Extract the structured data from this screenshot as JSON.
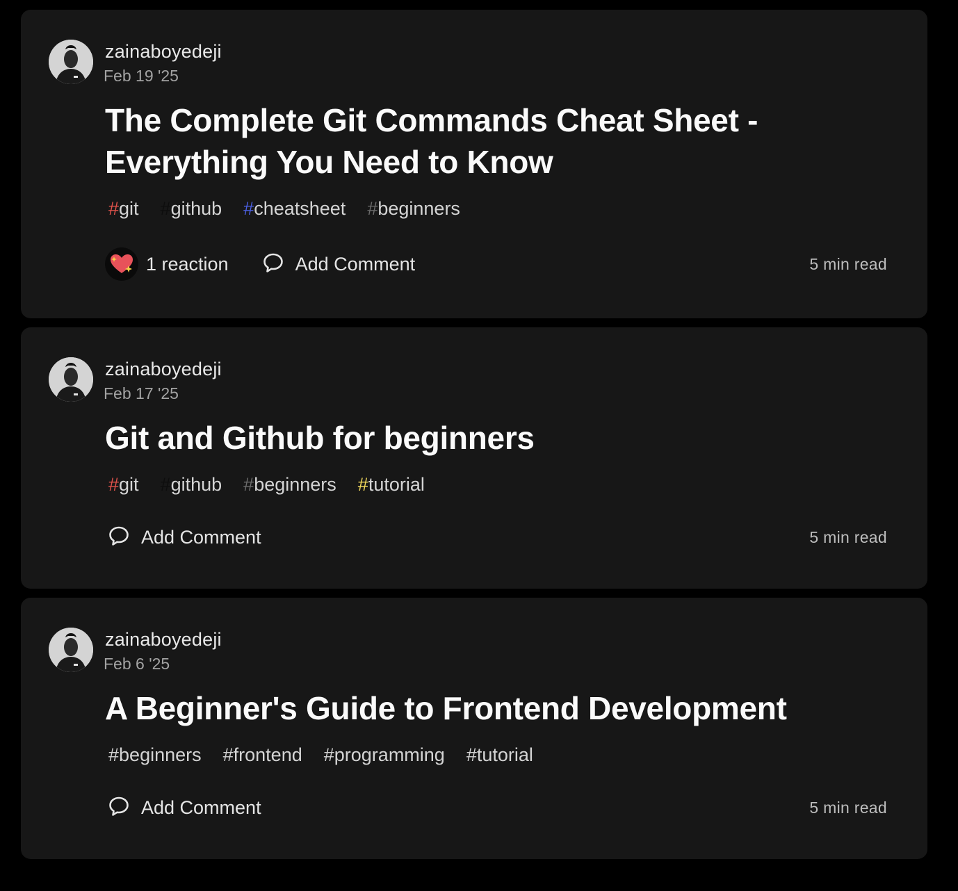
{
  "posts": [
    {
      "author": "zainaboyedeji",
      "date": "Feb 19 '25",
      "title": "The Complete Git Commands Cheat Sheet - Everything You Need to Know",
      "tags": [
        {
          "name": "git",
          "hash_color": "#e0524b"
        },
        {
          "name": "github",
          "hash_color": "#0d0d0d"
        },
        {
          "name": "cheatsheet",
          "hash_color": "#4b5fe0"
        },
        {
          "name": "beginners",
          "hash_color": "#6b6b6b"
        }
      ],
      "reaction_label": "1 reaction",
      "comment_label": "Add Comment",
      "read_time": "5 min read"
    },
    {
      "author": "zainaboyedeji",
      "date": "Feb 17 '25",
      "title": "Git and Github for beginners",
      "tags": [
        {
          "name": "git",
          "hash_color": "#e0524b"
        },
        {
          "name": "github",
          "hash_color": "#0d0d0d"
        },
        {
          "name": "beginners",
          "hash_color": "#6b6b6b"
        },
        {
          "name": "tutorial",
          "hash_color": "#f2d95c"
        }
      ],
      "comment_label": "Add Comment",
      "read_time": "5 min read"
    },
    {
      "author": "zainaboyedeji",
      "date": "Feb 6 '25",
      "title": "A Beginner's Guide to Frontend Development",
      "tags": [
        {
          "name": "beginners",
          "hash_color": "#d4d4d4"
        },
        {
          "name": "frontend",
          "hash_color": "#d4d4d4"
        },
        {
          "name": "programming",
          "hash_color": "#d4d4d4"
        },
        {
          "name": "tutorial",
          "hash_color": "#d4d4d4"
        }
      ],
      "comment_label": "Add Comment",
      "read_time": "5 min read"
    }
  ],
  "icons": {
    "avatar": "author-avatar",
    "reaction": "sparkle-heart-icon",
    "comment": "comment-bubble-icon"
  }
}
